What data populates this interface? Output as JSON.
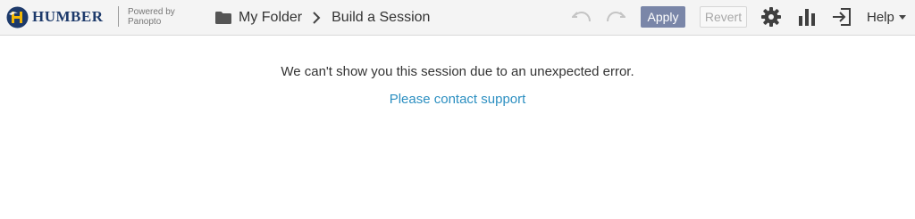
{
  "brand": {
    "name": "HUMBER",
    "powered_line1": "Powered by",
    "powered_line2": "Panopto",
    "logo_icon": "humber-hawk-logo",
    "colors": {
      "navy": "#1d3a6b",
      "gold": "#f2b705"
    }
  },
  "breadcrumb": {
    "folder_icon": "folder-icon",
    "folder_label": "My Folder",
    "separator_icon": "chevron-right-icon",
    "current": "Build a Session"
  },
  "toolbar": {
    "undo_icon": "undo-icon",
    "redo_icon": "redo-icon",
    "apply_label": "Apply",
    "revert_label": "Revert",
    "settings_icon": "gear-icon",
    "stats_icon": "bar-chart-icon",
    "exit_icon": "exit-icon",
    "help_label": "Help",
    "apply_color": "#7a86a8"
  },
  "content": {
    "error_message": "We can't show you this session due to an unexpected error.",
    "support_link": "Please contact support",
    "link_color": "#2c8fc1"
  }
}
